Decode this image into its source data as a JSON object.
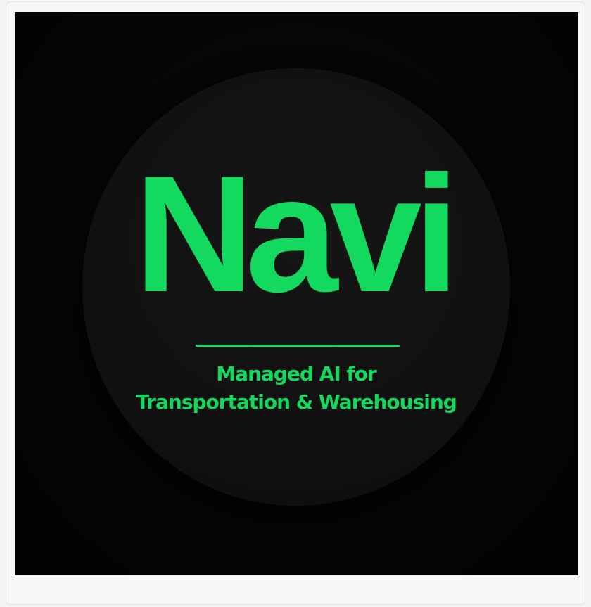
{
  "logo": {
    "wordmark": "Navi",
    "tagline_line1": "Managed AI for",
    "tagline_line2": "Transportation & Warehousing"
  },
  "colors": {
    "accent": "#13d95f",
    "background": "#050505",
    "badge": "#121212"
  }
}
